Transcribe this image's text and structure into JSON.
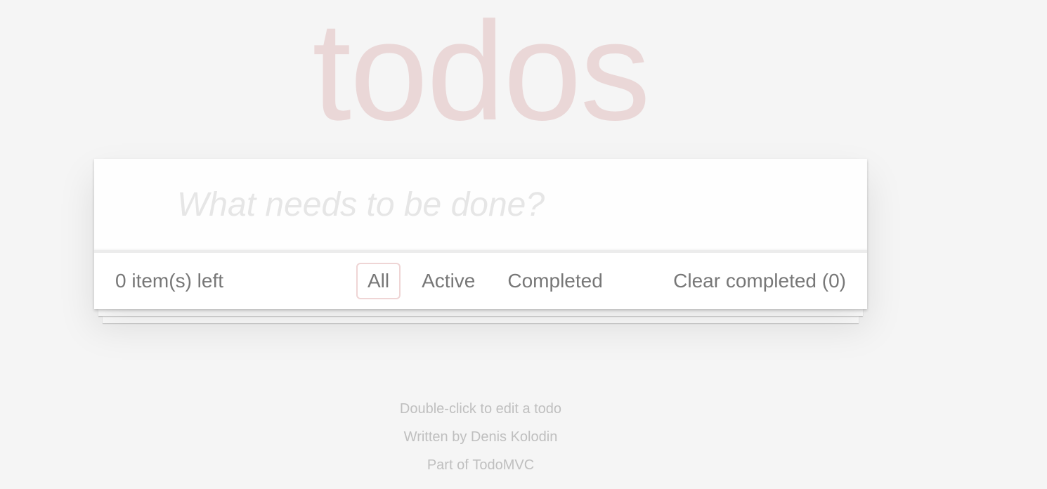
{
  "header": {
    "title": "todos"
  },
  "new_todo": {
    "placeholder": "What needs to be done?",
    "value": ""
  },
  "footer": {
    "items_left": "0 item(s) left",
    "filters": [
      {
        "label": "All",
        "selected": true
      },
      {
        "label": "Active",
        "selected": false
      },
      {
        "label": "Completed",
        "selected": false
      }
    ],
    "clear_completed": "Clear completed (0)"
  },
  "info": {
    "edit_hint": "Double-click to edit a todo",
    "written_by_prefix": "Written by",
    "author": "Denis Kolodin",
    "part_of_prefix": "Part of",
    "part_of_link": "TodoMVC"
  },
  "colors": {
    "background": "#f5f5f5",
    "title": "#ead7d7",
    "selected_filter_border": "#efd5d5",
    "text": "#777777"
  }
}
